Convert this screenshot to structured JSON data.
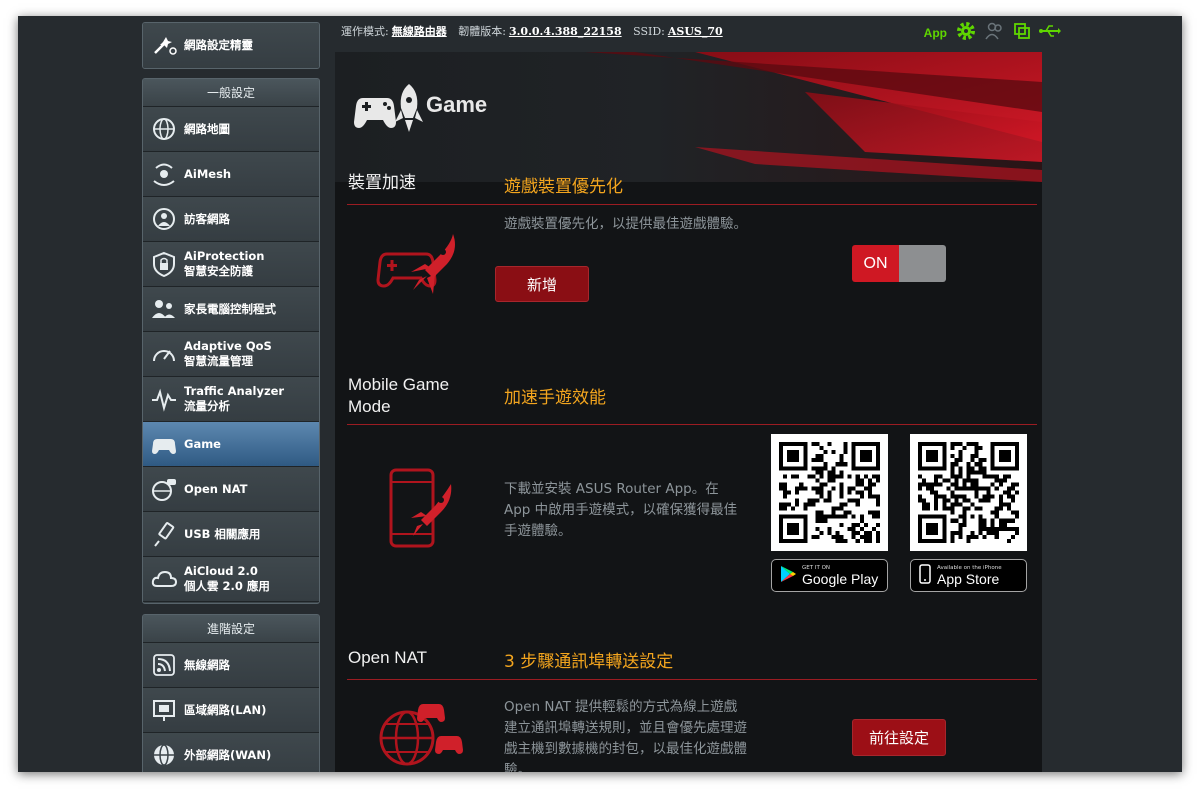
{
  "colors": {
    "accent_red": "#cf1823",
    "section_orange": "#f3a51e",
    "app_green": "#5fd600",
    "sidebar_active": "#3f6d98"
  },
  "sidebar": {
    "wizard_label": "網路設定精靈",
    "general_header": "一般設定",
    "general_items": [
      {
        "label": "網路地圖",
        "sub": "",
        "icon": "network-map-icon"
      },
      {
        "label": "AiMesh",
        "sub": "",
        "icon": "aimesh-icon"
      },
      {
        "label": "訪客網路",
        "sub": "",
        "icon": "guest-network-icon"
      },
      {
        "label": "AiProtection",
        "sub": "智慧安全防護",
        "icon": "shield-lock-icon"
      },
      {
        "label": "家長電腦控制程式",
        "sub": "",
        "icon": "parental-control-icon"
      },
      {
        "label": "Adaptive QoS",
        "sub": "智慧流量管理",
        "icon": "speedometer-icon"
      },
      {
        "label": "Traffic Analyzer",
        "sub": "流量分析",
        "icon": "traffic-analyzer-icon"
      },
      {
        "label": "Game",
        "sub": "",
        "icon": "gamepad-icon"
      },
      {
        "label": "Open NAT",
        "sub": "",
        "icon": "open-nat-icon"
      },
      {
        "label": "USB 相關應用",
        "sub": "",
        "icon": "usb-icon"
      },
      {
        "label": "AiCloud 2.0",
        "sub": "個人雲 2.0 應用",
        "icon": "cloud-icon"
      }
    ],
    "advanced_header": "進階設定",
    "advanced_items": [
      {
        "label": "無線網路",
        "sub": "",
        "icon": "wireless-icon"
      },
      {
        "label": "區域網路(LAN)",
        "sub": "",
        "icon": "lan-icon"
      },
      {
        "label": "外部網路(WAN)",
        "sub": "",
        "icon": "wan-globe-icon"
      }
    ]
  },
  "topbar": {
    "mode_label": "運作模式:",
    "mode_value": "無線路由器",
    "firmware_label": "韌體版本:",
    "firmware_value": "3.0.0.4.388_22158",
    "ssid_label": "SSID:",
    "ssid_value": "ASUS_70",
    "app_label": "App"
  },
  "main": {
    "title": "Game",
    "sections": {
      "boost": {
        "title": "裝置加速",
        "subtitle": "遊戲裝置優先化",
        "desc": "遊戲裝置優先化，以提供最佳遊戲體驗。",
        "button": "新增",
        "toggle_label": "ON"
      },
      "mobile": {
        "title_line1": "Mobile Game",
        "title_line2": "Mode",
        "subtitle": "加速手遊效能",
        "desc": "下載並安裝 ASUS Router App。在 App 中啟用手遊模式，以確保獲得最佳手遊體驗。",
        "google_small": "GET IT ON",
        "google_big": "Google Play",
        "apple_small": "Available on the iPhone",
        "apple_big": "App Store"
      },
      "nat": {
        "title": "Open NAT",
        "subtitle": "3 步驟通訊埠轉送設定",
        "desc": "Open NAT 提供輕鬆的方式為線上遊戲建立通訊埠轉送規則，並且會優先處理遊戲主機到數據機的封包，以最佳化遊戲體驗。",
        "button": "前往設定"
      }
    }
  }
}
